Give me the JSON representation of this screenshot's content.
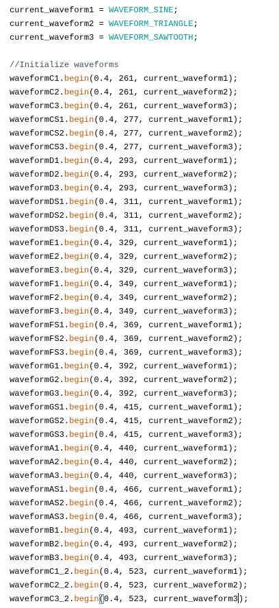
{
  "editor": {
    "colors": {
      "background": "#ffffff",
      "text": "#000000",
      "constant": "#00979c",
      "function": "#d35400",
      "comment": "#434f54",
      "bracket_match": "#4a90d9"
    },
    "assignments": [
      {
        "var": "current_waveform1",
        "op": " = ",
        "value": "WAVEFORM_SINE",
        "end": ";"
      },
      {
        "var": "current_waveform2",
        "op": " = ",
        "value": "WAVEFORM_TRIANGLE",
        "end": ";"
      },
      {
        "var": "current_waveform3",
        "op": " = ",
        "value": "WAVEFORM_SAWTOOTH",
        "end": ";"
      }
    ],
    "comment": "//Initialize waveforms",
    "calls": [
      {
        "obj": "waveformC1.",
        "fn": "begin",
        "args": "(0.4, 261, current_waveform1);"
      },
      {
        "obj": "waveformC2.",
        "fn": "begin",
        "args": "(0.4, 261, current_waveform2);"
      },
      {
        "obj": "waveformC3.",
        "fn": "begin",
        "args": "(0.4, 261, current_waveform3);"
      },
      {
        "obj": "waveformCS1.",
        "fn": "begin",
        "args": "(0.4, 277, current_waveform1);"
      },
      {
        "obj": "waveformCS2.",
        "fn": "begin",
        "args": "(0.4, 277, current_waveform2);"
      },
      {
        "obj": "waveformCS3.",
        "fn": "begin",
        "args": "(0.4, 277, current_waveform3);"
      },
      {
        "obj": "waveformD1.",
        "fn": "begin",
        "args": "(0.4, 293, current_waveform1);"
      },
      {
        "obj": "waveformD2.",
        "fn": "begin",
        "args": "(0.4, 293, current_waveform2);"
      },
      {
        "obj": "waveformD3.",
        "fn": "begin",
        "args": "(0.4, 293, current_waveform3);"
      },
      {
        "obj": "waveformDS1.",
        "fn": "begin",
        "args": "(0.4, 311, current_waveform1);"
      },
      {
        "obj": "waveformDS2.",
        "fn": "begin",
        "args": "(0.4, 311, current_waveform2);"
      },
      {
        "obj": "waveformDS3.",
        "fn": "begin",
        "args": "(0.4, 311, current_waveform3);"
      },
      {
        "obj": "waveformE1.",
        "fn": "begin",
        "args": "(0.4, 329, current_waveform1);"
      },
      {
        "obj": "waveformE2.",
        "fn": "begin",
        "args": "(0.4, 329, current_waveform2);"
      },
      {
        "obj": "waveformE3.",
        "fn": "begin",
        "args": "(0.4, 329, current_waveform3);"
      },
      {
        "obj": "waveformF1.",
        "fn": "begin",
        "args": "(0.4, 349, current_waveform1);"
      },
      {
        "obj": "waveformF2.",
        "fn": "begin",
        "args": "(0.4, 349, current_waveform2);"
      },
      {
        "obj": "waveformF3.",
        "fn": "begin",
        "args": "(0.4, 349, current_waveform3);"
      },
      {
        "obj": "waveformFS1.",
        "fn": "begin",
        "args": "(0.4, 369, current_waveform1);"
      },
      {
        "obj": "waveformFS2.",
        "fn": "begin",
        "args": "(0.4, 369, current_waveform2);"
      },
      {
        "obj": "waveformFS3.",
        "fn": "begin",
        "args": "(0.4, 369, current_waveform3);"
      },
      {
        "obj": "waveformG1.",
        "fn": "begin",
        "args": "(0.4, 392, current_waveform1);"
      },
      {
        "obj": "waveformG2.",
        "fn": "begin",
        "args": "(0.4, 392, current_waveform2);"
      },
      {
        "obj": "waveformG3.",
        "fn": "begin",
        "args": "(0.4, 392, current_waveform3);"
      },
      {
        "obj": "waveformGS1.",
        "fn": "begin",
        "args": "(0.4, 415, current_waveform1);"
      },
      {
        "obj": "waveformGS2.",
        "fn": "begin",
        "args": "(0.4, 415, current_waveform2);"
      },
      {
        "obj": "waveformGS3.",
        "fn": "begin",
        "args": "(0.4, 415, current_waveform3);"
      },
      {
        "obj": "waveformA1.",
        "fn": "begin",
        "args": "(0.4, 440, current_waveform1);"
      },
      {
        "obj": "waveformA2.",
        "fn": "begin",
        "args": "(0.4, 440, current_waveform2);"
      },
      {
        "obj": "waveformA3.",
        "fn": "begin",
        "args": "(0.4, 440, current_waveform3);"
      },
      {
        "obj": "waveformAS1.",
        "fn": "begin",
        "args": "(0.4, 466, current_waveform1);"
      },
      {
        "obj": "waveformAS2.",
        "fn": "begin",
        "args": "(0.4, 466, current_waveform2);"
      },
      {
        "obj": "waveformAS3.",
        "fn": "begin",
        "args": "(0.4, 466, current_waveform3);"
      },
      {
        "obj": "waveformB1.",
        "fn": "begin",
        "args": "(0.4, 493, current_waveform1);"
      },
      {
        "obj": "waveformB2.",
        "fn": "begin",
        "args": "(0.4, 493, current_waveform2);"
      },
      {
        "obj": "waveformB3.",
        "fn": "begin",
        "args": "(0.4, 493, current_waveform3);"
      },
      {
        "obj": "waveformC1_2.",
        "fn": "begin",
        "args": "(0.4, 523, current_waveform1);"
      },
      {
        "obj": "waveformC2_2.",
        "fn": "begin",
        "args": "(0.4, 523, current_waveform2);"
      }
    ],
    "last_call": {
      "obj": "waveformC3_2.",
      "fn": "begin",
      "open_paren": "(",
      "args_before_caret": "0.4, 523, current_waveform3",
      "args_after_caret": ");"
    }
  }
}
